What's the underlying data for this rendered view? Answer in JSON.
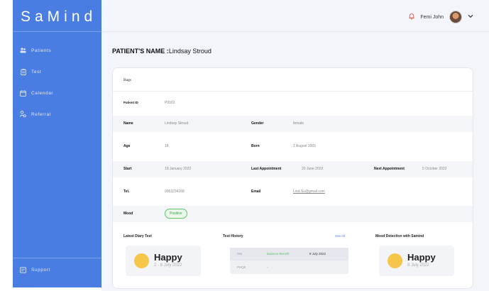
{
  "app": {
    "brand": "SaMind"
  },
  "sidebar": {
    "items": [
      {
        "label": "Patients",
        "icon": "users-icon"
      },
      {
        "label": "Test",
        "icon": "clipboard-icon"
      },
      {
        "label": "Calendar",
        "icon": "calendar-icon"
      },
      {
        "label": "Referral",
        "icon": "referral-icon"
      }
    ],
    "support_label": "Support"
  },
  "topbar": {
    "user_name": "Femi John",
    "notification_icon": "bell-icon",
    "menu_icon": "chevron-down-icon"
  },
  "patient": {
    "title_label": "PATIENT'S NAME :",
    "name": "Lindsay Stroud"
  },
  "card": {
    "header_label": "Bags",
    "rows": {
      "patient_id": {
        "label": "Patient ID",
        "value": "P0002"
      },
      "name": {
        "label": "Name",
        "value": "Lindsay Stroud"
      },
      "gender": {
        "label": "Gender",
        "value": "female"
      },
      "age": {
        "label": "Age",
        "value": "18"
      },
      "born": {
        "label": "Born",
        "value": "1 August 2005"
      },
      "start": {
        "label": "Start",
        "value": "19 January 2022"
      },
      "last_appt": {
        "label": "Last Appointment",
        "value": "20 June 2022"
      },
      "next_appt": {
        "label": "Next Appointment",
        "value": "5 October 2022"
      },
      "tel": {
        "label": "Tel.",
        "value": "0953234168"
      },
      "email": {
        "label": "Email",
        "value": "Lind.Su@gmail.com"
      },
      "mood": {
        "label": "Mood",
        "value": "Positive"
      }
    },
    "latest_diary": {
      "label": "Latest Diary Test",
      "mood": "Happy",
      "date": "2 - 8 July 2022"
    },
    "test_history": {
      "label": "Test History",
      "see_all": "See All",
      "rows": [
        {
          "name": "ISS",
          "result": "Balance Benefit",
          "date": "8 July 2022"
        },
        {
          "name": "PHQ9",
          "result": "-",
          "date": ""
        }
      ]
    },
    "mood_detection": {
      "label": "Mood Detection with Samind",
      "mood": "Happy",
      "date": "8 July 2022"
    }
  },
  "colors": {
    "sidebar": "#4a7de2",
    "positive": "#3aa845",
    "sun": "#f6c64a",
    "link": "#4a7de2"
  }
}
